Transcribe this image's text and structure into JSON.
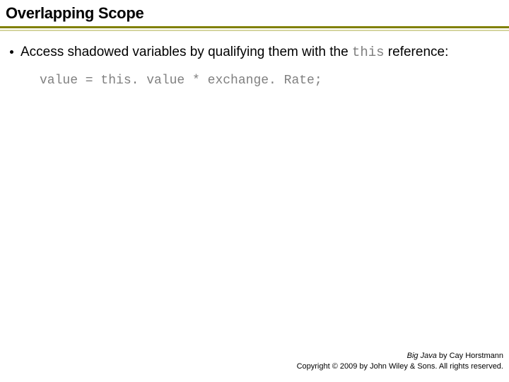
{
  "title": "Overlapping Scope",
  "bullet": {
    "pre": "Access shadowed variables by qualifying them with the ",
    "code": "this",
    "post": " reference:"
  },
  "code_line": "value = this. value * exchange. Rate;",
  "footer": {
    "book": "Big Java",
    "by": " by Cay Horstmann",
    "copyright": "Copyright © 2009 by John Wiley & Sons. All rights reserved."
  }
}
